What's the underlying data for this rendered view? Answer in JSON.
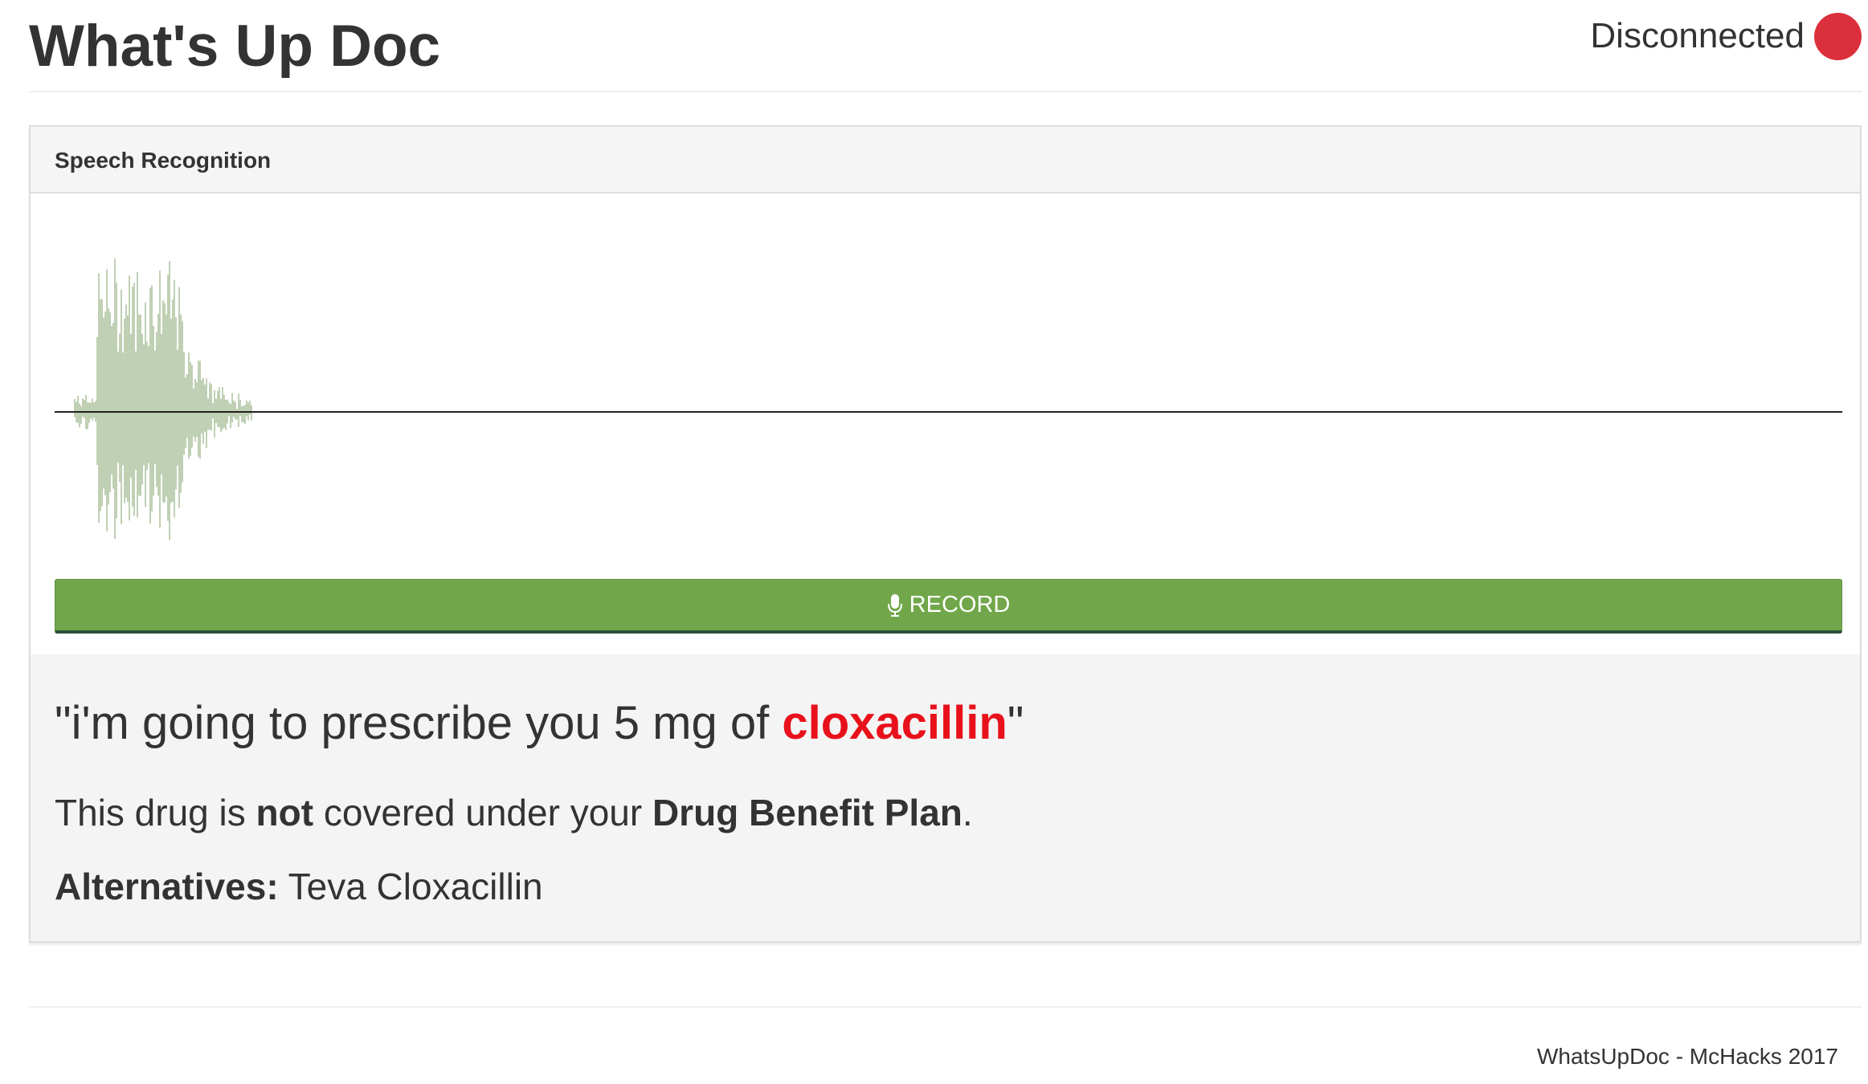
{
  "header": {
    "title": "What's Up Doc",
    "connection_status": "Disconnected",
    "status_color": "#dc2f3c"
  },
  "panel": {
    "title": "Speech Recognition",
    "record_button": {
      "label": "RECORD",
      "icon": "microphone-icon",
      "color": "#71a74a"
    },
    "waveform_color": "#c0d0b4"
  },
  "result": {
    "transcript_open": "\"i'm going to prescribe you 5 mg of ",
    "drug_name": "cloxacillin",
    "drug_color": "#e8111b",
    "transcript_close": "\"",
    "coverage_prefix": "This drug is ",
    "coverage_emphasis": "not",
    "coverage_middle": " covered under your ",
    "coverage_plan": "Drug Benefit Plan",
    "coverage_suffix": ".",
    "alternatives_label": "Alternatives:",
    "alternatives_value": " Teva Cloxacillin"
  },
  "footer": {
    "credits": "WhatsUpDoc - McHacks 2017"
  }
}
